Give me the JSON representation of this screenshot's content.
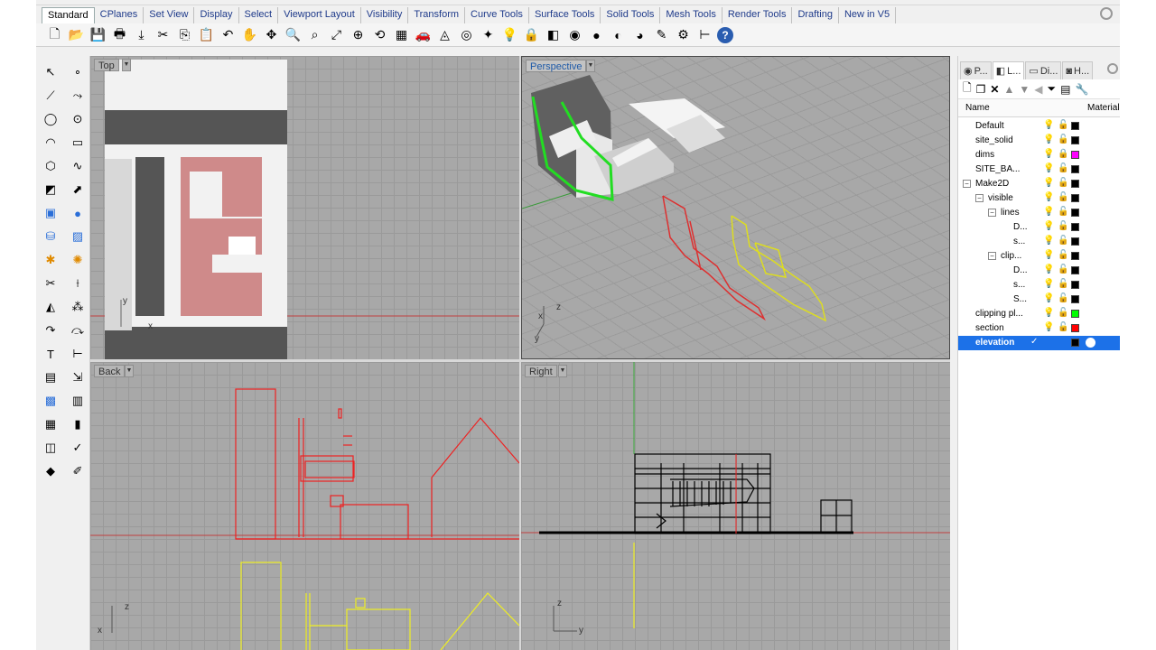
{
  "tabs": [
    "Standard",
    "CPlanes",
    "Set View",
    "Display",
    "Select",
    "Viewport Layout",
    "Visibility",
    "Transform",
    "Curve Tools",
    "Surface Tools",
    "Solid Tools",
    "Mesh Tools",
    "Render Tools",
    "Drafting",
    "New in V5"
  ],
  "active_tab": "Standard",
  "toolbar_icons": [
    "new-file-icon",
    "open-folder-icon",
    "save-icon",
    "print-icon",
    "import-icon",
    "cut-icon",
    "copy-icon",
    "paste-icon",
    "undo-icon",
    "pan-hand-icon",
    "move-icon",
    "zoom-icon",
    "zoom-window-icon",
    "zoom-extents-icon",
    "zoom-selected-icon",
    "rotate-view-icon",
    "grid-icon",
    "car-icon",
    "named-view-icon",
    "cplane-icon",
    "point-icon",
    "light-icon",
    "lock-icon",
    "layer-icon",
    "color-wheel-icon",
    "render-sphere-icon",
    "material-sphere-icon",
    "environment-sphere-icon",
    "options-icon",
    "gear-settings-icon",
    "dimension-icon",
    "help-icon"
  ],
  "viewports": {
    "top": "Top",
    "perspective": "Perspective",
    "back": "Back",
    "right": "Right"
  },
  "layers_panel": {
    "tabs": [
      "P...",
      "L...",
      "Di...",
      "H..."
    ],
    "col_name": "Name",
    "col_material": "Material",
    "layers": [
      {
        "name": "Default",
        "indent": 0,
        "color": "#000000"
      },
      {
        "name": "site_solid",
        "indent": 0,
        "color": "#000000"
      },
      {
        "name": "dims",
        "indent": 0,
        "color": "#ff00ff"
      },
      {
        "name": "SITE_BA...",
        "indent": 0,
        "color": "#000000"
      },
      {
        "name": "Make2D",
        "indent": 0,
        "color": "#000000",
        "expander": "⊟"
      },
      {
        "name": "visible",
        "indent": 1,
        "color": "#000000",
        "expander": "⊟"
      },
      {
        "name": "lines",
        "indent": 2,
        "color": "#000000",
        "expander": "⊟"
      },
      {
        "name": "D...",
        "indent": 3,
        "color": "#000000"
      },
      {
        "name": "s...",
        "indent": 3,
        "color": "#000000"
      },
      {
        "name": "clip...",
        "indent": 2,
        "color": "#000000",
        "expander": "⊟"
      },
      {
        "name": "D...",
        "indent": 3,
        "color": "#000000"
      },
      {
        "name": "s...",
        "indent": 3,
        "color": "#000000"
      },
      {
        "name": "S...",
        "indent": 3,
        "color": "#000000"
      },
      {
        "name": "clipping pl...",
        "indent": 0,
        "color": "#00ff00"
      },
      {
        "name": "section",
        "indent": 0,
        "color": "#ff0000"
      },
      {
        "name": "elevation",
        "indent": 0,
        "color": "#000000",
        "selected": true,
        "current": "✓"
      }
    ]
  },
  "axis_labels": {
    "top_y": "y",
    "top_x": "x",
    "persp_z": "z",
    "persp_x": "x",
    "persp_y": "y",
    "back_z": "z",
    "back_x": "x",
    "right_z": "z",
    "right_y": "y"
  }
}
